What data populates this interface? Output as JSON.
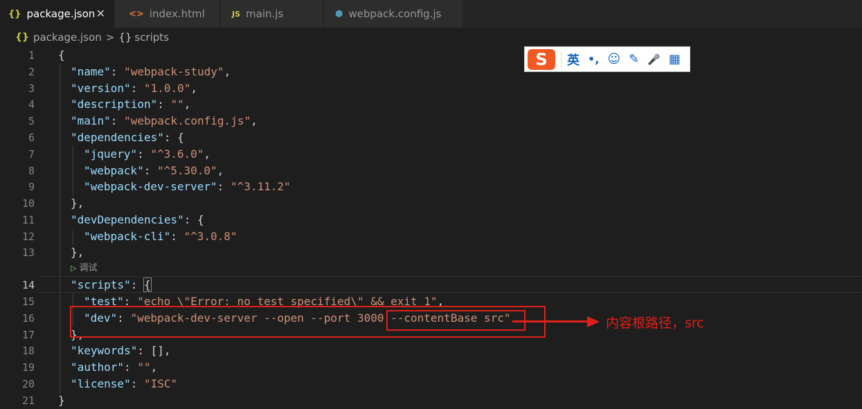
{
  "tabs": [
    {
      "label": "package.json",
      "icon": "json-braces-icon",
      "glyph": "{}",
      "color": "#cbcb41",
      "active": true
    },
    {
      "label": "index.html",
      "icon": "html-icon",
      "glyph": "<>",
      "color": "#e37933",
      "active": false
    },
    {
      "label": "main.js",
      "icon": "js-icon",
      "glyph": "JS",
      "color": "#cbcb41",
      "active": false
    },
    {
      "label": "webpack.config.js",
      "icon": "webpack-cube-icon",
      "glyph": "⬢",
      "color": "#519aba",
      "active": false
    }
  ],
  "close_glyph": "✕",
  "breadcrumb": {
    "file": "package.json",
    "separator": ">",
    "symbol_icon": "{}",
    "symbol": "scripts"
  },
  "codelens": "调试",
  "line_numbers": [
    "1",
    "2",
    "3",
    "4",
    "5",
    "6",
    "7",
    "8",
    "9",
    "10",
    "11",
    "12",
    "13",
    "14",
    "15",
    "16",
    "17",
    "18",
    "19",
    "20",
    "21"
  ],
  "code": {
    "l1": "{",
    "l2_key": "\"name\"",
    "l2_val": "\"webpack-study\"",
    "l3_key": "\"version\"",
    "l3_val": "\"1.0.0\"",
    "l4_key": "\"description\"",
    "l4_val": "\"\"",
    "l5_key": "\"main\"",
    "l5_val": "\"webpack.config.js\"",
    "l6_key": "\"dependencies\"",
    "l7_key": "\"jquery\"",
    "l7_val": "\"^3.6.0\"",
    "l8_key": "\"webpack\"",
    "l8_val": "\"^5.30.0\"",
    "l9_key": "\"webpack-dev-server\"",
    "l9_val": "\"^3.11.2\"",
    "l10": "},",
    "l11_key": "\"devDependencies\"",
    "l12_key": "\"webpack-cli\"",
    "l12_val": "\"^3.0.8\"",
    "l13": "},",
    "l14_key": "\"scripts\"",
    "l15_key": "\"test\"",
    "l15_val": "\"echo \\\"Error: no test specified\\\" && exit 1\"",
    "l16_key": "\"dev\"",
    "l16_val": "\"webpack-dev-server --open --port 3000 --contentBase src\"",
    "l17": "},",
    "l18_key": "\"keywords\"",
    "l18_val": "[]",
    "l19_key": "\"author\"",
    "l19_val": "\"\"",
    "l20_key": "\"license\"",
    "l20_val": "\"ISC\"",
    "l21": "}"
  },
  "annotation": "内容根路径，src",
  "ime": {
    "logo": "S",
    "lang": "英",
    "punct": "•,",
    "icons": [
      "emoji-icon",
      "pen-icon",
      "mic-icon",
      "grid-icon"
    ],
    "glyphs": [
      "☺",
      "✎",
      "🎤",
      "▦"
    ]
  },
  "colors": {
    "background": "#1e1e1e",
    "key": "#9cdcfe",
    "string": "#ce9178",
    "annotation": "#e0201a"
  }
}
